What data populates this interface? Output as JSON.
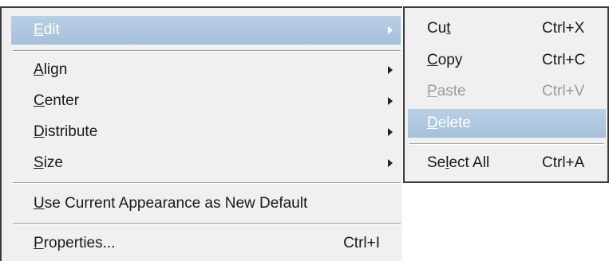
{
  "main_menu": {
    "items": [
      {
        "mnemonic": "E",
        "rest": "dit",
        "has_submenu": true,
        "highlighted": true
      },
      {
        "mnemonic": "A",
        "rest": "lign",
        "has_submenu": true
      },
      {
        "mnemonic": "C",
        "rest": "enter",
        "has_submenu": true
      },
      {
        "mnemonic": "D",
        "rest": "istribute",
        "has_submenu": true
      },
      {
        "mnemonic": "S",
        "rest": "ize",
        "has_submenu": true
      },
      {
        "mnemonic": "U",
        "rest": "se Current Appearance as New Default"
      },
      {
        "mnemonic": "P",
        "rest": "roperties...",
        "shortcut": "Ctrl+I"
      }
    ]
  },
  "edit_submenu": {
    "items": [
      {
        "pre": "Cu",
        "mnemonic": "t",
        "rest": "",
        "shortcut": "Ctrl+X"
      },
      {
        "pre": "",
        "mnemonic": "C",
        "rest": "opy",
        "shortcut": "Ctrl+C"
      },
      {
        "pre": "",
        "mnemonic": "P",
        "rest": "aste",
        "shortcut": "Ctrl+V",
        "disabled": true
      },
      {
        "pre": "",
        "mnemonic": "D",
        "rest": "elete",
        "shortcut": "",
        "highlighted": true
      },
      {
        "pre": "Se",
        "mnemonic": "l",
        "rest": "ect All",
        "shortcut": "Ctrl+A"
      }
    ]
  },
  "colors": {
    "highlight": "#a6c0db",
    "menu_bg": "#f0f0f0",
    "disabled_text": "#9c9c9c"
  }
}
